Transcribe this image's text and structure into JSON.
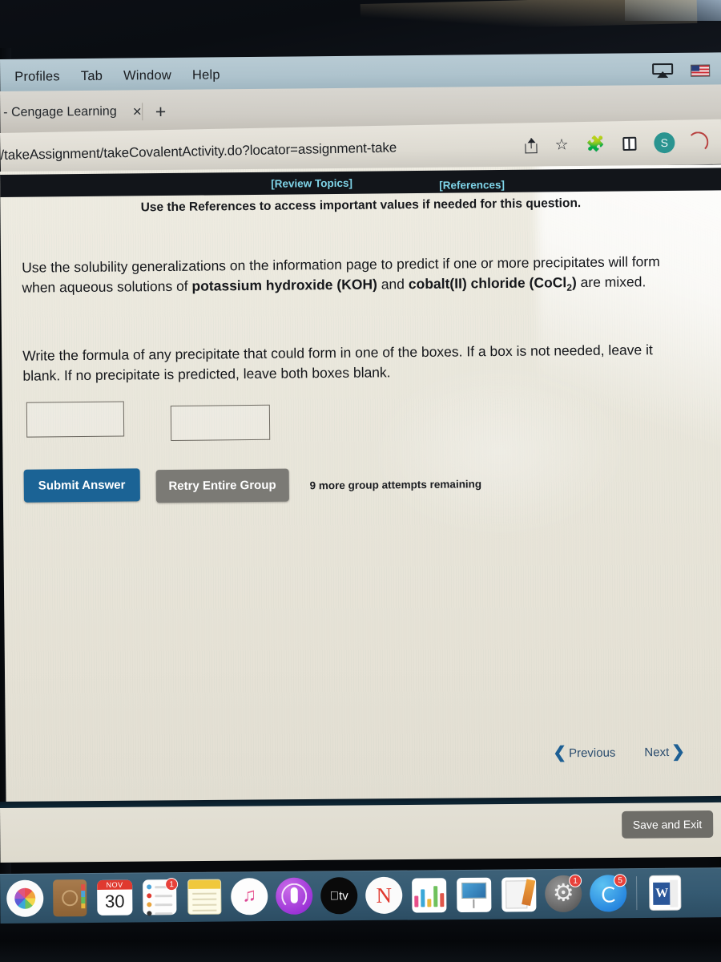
{
  "menubar": {
    "items": [
      "Profiles",
      "Tab",
      "Window",
      "Help"
    ],
    "airplay_icon": "airplay-icon",
    "flag_icon": "us-flag-input-icon"
  },
  "browser": {
    "tab": {
      "title": "- Cengage Learning",
      "close_label": "×",
      "new_tab_label": "+"
    },
    "url": "/takeAssignment/takeCovalentActivity.do?locator=assignment-take",
    "toolbar_icons": [
      "share-icon",
      "bookmark-star-icon",
      "extensions-puzzle-icon",
      "sidebar-toggle-icon",
      "profile-avatar-s"
    ],
    "avatar_initial": "S",
    "avatar_color": "#2a9490"
  },
  "page": {
    "top_links": {
      "review_topics": "[Review Topics]",
      "references": "[References]",
      "link_color": "#7fd4e8"
    },
    "reference_note": "Use the References to access important values if needed for this question.",
    "question": {
      "paragraph1_prefix": "Use the solubility generalizations on the information page to predict if one or more precipitates will form when aqueous solutions of ",
      "compound1_name": "potassium hydroxide",
      "compound1_formula": "(KOH)",
      "conjunction": " and ",
      "compound2_name": "cobalt(II) chloride",
      "compound2_formula_base": "(CoCl",
      "compound2_formula_sub": "2",
      "compound2_formula_close": ")",
      "paragraph1_suffix": " are mixed.",
      "paragraph2": "Write the formula of any precipitate that could form in one of the boxes. If a box is not needed, leave it blank. If no precipitate is predicted, leave both boxes blank."
    },
    "answers": {
      "box1_value": "",
      "box2_value": "",
      "box1_placeholder": "",
      "box2_placeholder": ""
    },
    "buttons": {
      "submit": "Submit Answer",
      "retry": "Retry Entire Group",
      "submit_color": "#1b6395",
      "retry_color": "#7b7a75",
      "save_and_exit": "Save and Exit"
    },
    "attempts_text": "9 more group attempts remaining",
    "navigation": {
      "previous": "Previous",
      "next": "Next",
      "prev_chevron": "❮",
      "next_chevron": "❯"
    }
  },
  "dock": {
    "items": [
      {
        "name": "photos",
        "label": "Photos"
      },
      {
        "name": "contacts",
        "label": "Contacts"
      },
      {
        "name": "calendar",
        "label": "Calendar",
        "month": "NOV",
        "day": "30"
      },
      {
        "name": "reminders",
        "label": "Reminders",
        "badge": "1"
      },
      {
        "name": "notes",
        "label": "Notes"
      },
      {
        "name": "music",
        "label": "Music"
      },
      {
        "name": "podcasts",
        "label": "Podcasts"
      },
      {
        "name": "apple-tv",
        "label": "tv"
      },
      {
        "name": "news",
        "label": "News"
      },
      {
        "name": "numbers",
        "label": "Numbers"
      },
      {
        "name": "keynote",
        "label": "Keynote"
      },
      {
        "name": "pages",
        "label": "Pages"
      },
      {
        "name": "system-preferences",
        "label": "System Preferences",
        "badge": "1"
      },
      {
        "name": "app-store",
        "label": "App Store",
        "badge": "5"
      },
      {
        "name": "microsoft-word",
        "label": "Microsoft Word",
        "letter": "W"
      }
    ]
  }
}
